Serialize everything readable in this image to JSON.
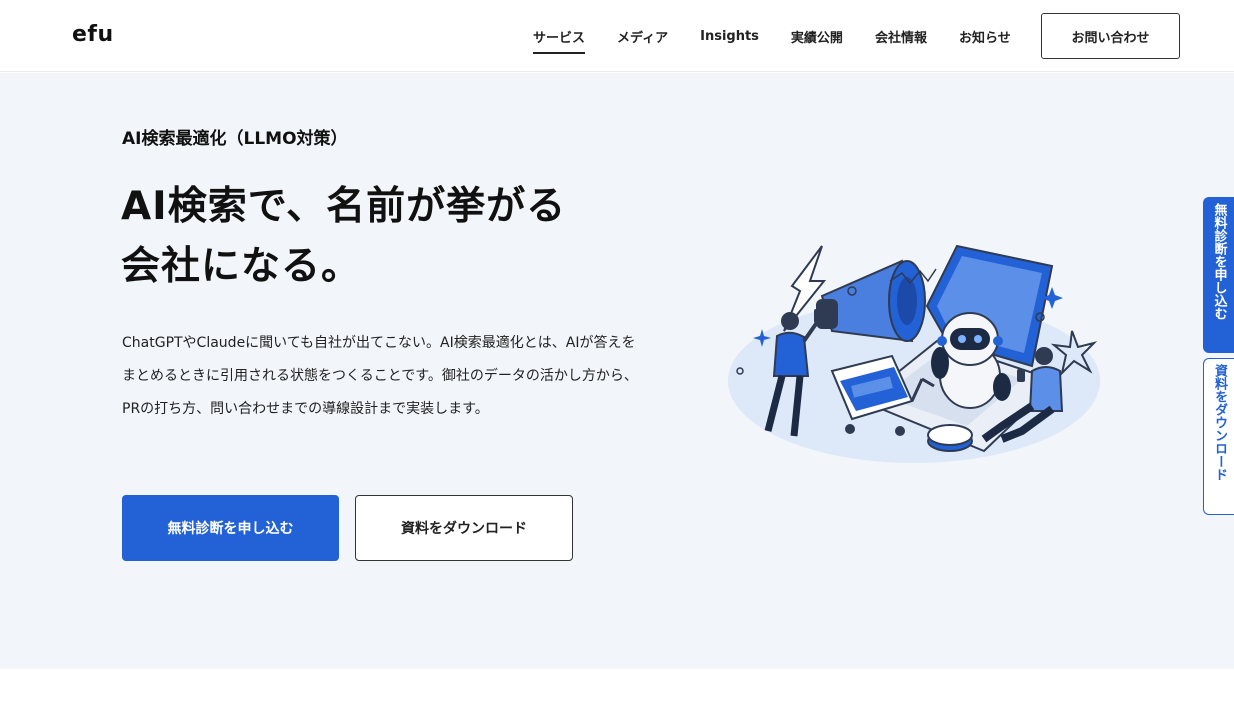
{
  "header": {
    "logo": "efu",
    "nav": [
      {
        "label": "サービス",
        "active": true
      },
      {
        "label": "メディア",
        "active": false
      },
      {
        "label": "Insights",
        "active": false
      },
      {
        "label": "実績公開",
        "active": false
      },
      {
        "label": "会社情報",
        "active": false
      },
      {
        "label": "お知らせ",
        "active": false
      }
    ],
    "contact_label": "お問い合わせ"
  },
  "hero": {
    "eyebrow": "AI検索最適化（LLMO対策）",
    "headline_line1": "AI検索で、名前が挙がる",
    "headline_line2": "会社になる。",
    "description": "ChatGPTやClaudeに聞いても自社が出てこない。AI検索最適化とは、AIが答えをまとめるときに引用される状態をつくることです。御社のデータの活かし方から、PRの打ち方、問い合わせまでの導線設計まで実装します。",
    "primary_cta": "無料診断を申し込む",
    "secondary_cta": "資料をダウンロード",
    "illustration_icon": "ai-search-illustration"
  },
  "side_tabs": {
    "primary": "無料診断を申し込む",
    "secondary": "資料をダウンロード"
  },
  "colors": {
    "accent": "#2262d6",
    "hero_bg": "#f2f5fa",
    "text": "#1a1a1a"
  }
}
